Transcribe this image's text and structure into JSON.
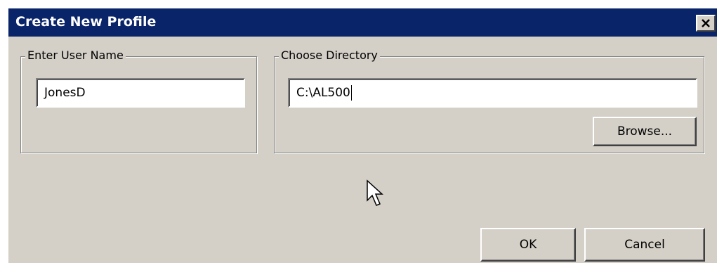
{
  "dialog": {
    "title": "Create New Profile",
    "close_glyph": "✕"
  },
  "user_group": {
    "legend": "Enter User Name",
    "value": "JonesD"
  },
  "directory_group": {
    "legend": "Choose Directory",
    "value": "C:\\AL500",
    "browse_label": "Browse..."
  },
  "footer": {
    "ok_label": "OK",
    "cancel_label": "Cancel"
  },
  "icons": {
    "close": "close-icon",
    "cursor": "mouse-pointer-icon"
  },
  "colors": {
    "titlebar": "#0a246a",
    "face": "#d4d0c8"
  }
}
